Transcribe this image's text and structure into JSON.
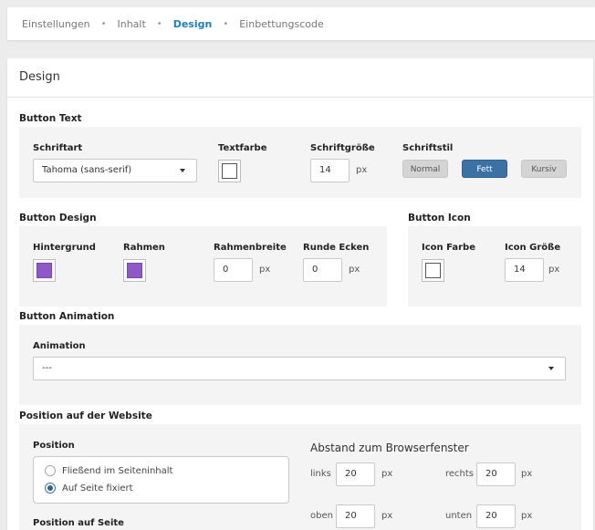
{
  "breadcrumb": {
    "items": [
      "Einstellungen",
      "Inhalt",
      "Design",
      "Einbettungscode"
    ],
    "separator": "•",
    "active_index": 2
  },
  "panel": {
    "title": "Design"
  },
  "button_text": {
    "heading": "Button Text",
    "font_label": "Schriftart",
    "font_value": "Tahoma (sans-serif)",
    "text_color_label": "Textfarbe",
    "text_color": "#ffffff",
    "font_size_label": "Schriftgröße",
    "font_size_value": "14",
    "font_size_unit": "px",
    "font_style_label": "Schriftstil",
    "styles": [
      "Normal",
      "Fett",
      "Kursiv"
    ],
    "active_style": "Fett"
  },
  "button_design": {
    "heading": "Button Design",
    "background_label": "Hintergrund",
    "background_color": "#8e58c6",
    "border_label": "Rahmen",
    "border_color": "#8e58c6",
    "border_width_label": "Rahmenbreite",
    "border_width_value": "0",
    "border_width_unit": "px",
    "radius_label": "Runde Ecken",
    "radius_value": "0",
    "radius_unit": "px"
  },
  "button_icon": {
    "heading": "Button Icon",
    "color_label": "Icon Farbe",
    "color": "#ffffff",
    "size_label": "Icon Größe",
    "size_value": "14",
    "size_unit": "px"
  },
  "button_animation": {
    "heading": "Button Animation",
    "animation_label": "Animation",
    "animation_value": "---"
  },
  "position": {
    "heading": "Position auf der Website",
    "position_label": "Position",
    "options": [
      "Fließend im Seiteninhalt",
      "Auf Seite fixiert"
    ],
    "selected": "Auf Seite fixiert",
    "page_position_label": "Position auf Seite",
    "distance_heading": "Abstand zum Browserfenster",
    "left_label": "links",
    "left_value": "20",
    "right_label": "rechts",
    "right_value": "20",
    "top_label": "oben",
    "top_value": "20",
    "bottom_label": "unten",
    "bottom_value": "20",
    "unit": "px"
  }
}
